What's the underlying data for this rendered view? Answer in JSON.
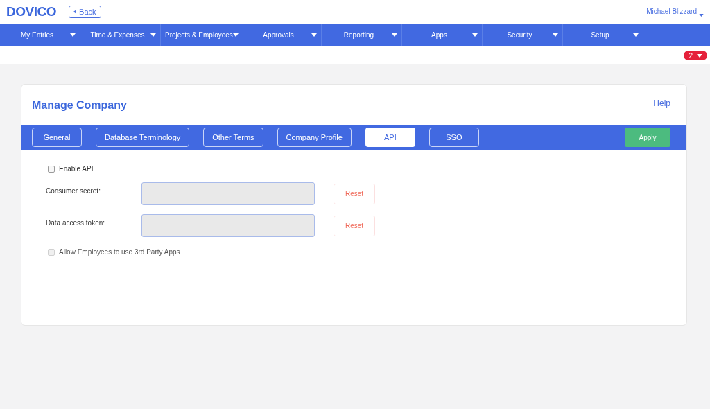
{
  "logo": "DOVICO",
  "back_button": "Back",
  "user_menu": "Michael Blizzard",
  "nav": [
    {
      "label": "My Entries"
    },
    {
      "label": "Time & Expenses"
    },
    {
      "label": "Projects & Employees"
    },
    {
      "label": "Approvals"
    },
    {
      "label": "Reporting"
    },
    {
      "label": "Apps"
    },
    {
      "label": "Security"
    },
    {
      "label": "Setup"
    }
  ],
  "notification_badge": "2",
  "page": {
    "title": "Manage Company",
    "help": "Help"
  },
  "tabs": [
    {
      "label": "General",
      "selected": false
    },
    {
      "label": "Database Terminology",
      "selected": false
    },
    {
      "label": "Other Terms",
      "selected": false
    },
    {
      "label": "Company Profile",
      "selected": false
    },
    {
      "label": "API",
      "selected": true
    },
    {
      "label": "SSO",
      "selected": false
    }
  ],
  "apply_button": "Apply",
  "enable_api": {
    "label": "Enable API",
    "checked": false,
    "disabled": false
  },
  "fields": [
    {
      "label": "Consumer secret:",
      "button": "Reset"
    },
    {
      "label": "Data access token:",
      "button": "Reset"
    }
  ],
  "allow_third_party": {
    "label": "Allow Employees to use 3rd Party Apps",
    "checked": false,
    "disabled": true
  }
}
